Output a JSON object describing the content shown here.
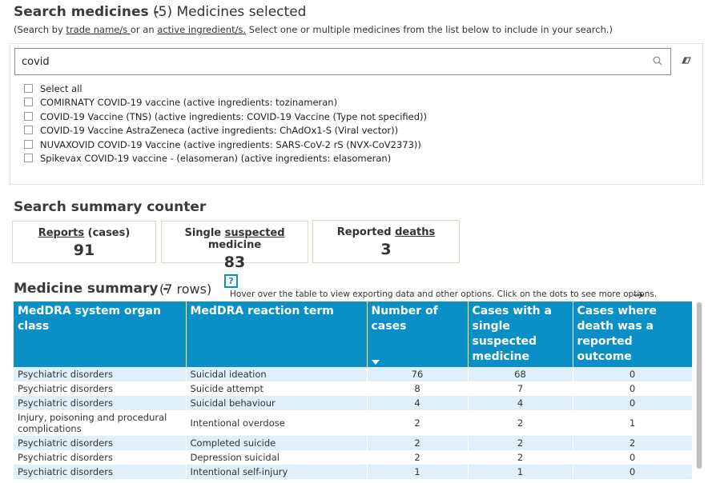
{
  "search": {
    "title": "Search medicines -",
    "selected_count": "(5) Medicines selected",
    "hint_prefix": "(Search by ",
    "hint_link1": "trade name/s ",
    "hint_mid": "or an ",
    "hint_link2": "active ingredient/s.",
    "hint_suffix": " Select one or multiple medicines from the list below to include in your search.)",
    "query": "covid",
    "options": [
      "Select all",
      "COMIRNATY COVID-19 vaccine (active ingredients: tozinameran)",
      "COVID-19 Vaccine (TNS) (active ingredients: COVID-19 Vaccine (Type not specified))",
      "COVID-19 Vaccine AstraZeneca (active ingredients: ChAdOx1-S (Viral vector))",
      "NUVAXOVID COVID-19 Vaccine (active ingredients: SARS-CoV-2 rS (NVX-CoV2373))",
      "Spikevax COVID-19 vaccine - (elasomeran) (active ingredients: elasomeran)"
    ]
  },
  "summary": {
    "title": "Search summary counter",
    "cards": [
      {
        "pre": "",
        "link": "Reports",
        "post": " (cases)",
        "value": "91"
      },
      {
        "pre": "Single ",
        "link": "suspected",
        "post": " medicine",
        "value": "83"
      },
      {
        "pre": "Reported ",
        "link": "deaths",
        "post": "",
        "value": "3"
      }
    ]
  },
  "medicine": {
    "title": "Medicine summary -",
    "rows_label": "(7 rows)",
    "help_label": "?",
    "hover_hint": "Hover over the table to view exporting data and other options. Click on the dots to see more options.",
    "columns": [
      "MedDRA system organ class",
      "MedDRA reaction term",
      "Number of cases",
      "Cases with a single suspected medicine",
      "Cases where death was a reported outcome"
    ],
    "rows": [
      [
        "Psychiatric disorders",
        "Suicidal ideation",
        "76",
        "68",
        "0"
      ],
      [
        "Psychiatric disorders",
        "Suicide attempt",
        "8",
        "7",
        "0"
      ],
      [
        "Psychiatric disorders",
        "Suicidal behaviour",
        "4",
        "4",
        "0"
      ],
      [
        "Injury, poisoning and procedural complications",
        "Intentional overdose",
        "2",
        "2",
        "1"
      ],
      [
        "Psychiatric disorders",
        "Completed suicide",
        "2",
        "2",
        "2"
      ],
      [
        "Psychiatric disorders",
        "Depression suicidal",
        "2",
        "2",
        "0"
      ],
      [
        "Psychiatric disorders",
        "Intentional self-injury",
        "1",
        "1",
        "0"
      ]
    ]
  },
  "icons": {
    "search": "search-icon",
    "clear": "eraser-icon",
    "help": "help-icon",
    "arrow": "arrow-right-icon",
    "sort": "sort-desc-icon"
  },
  "colors": {
    "header_bg": "#0a8fc7",
    "alt_row": "#dff0fb",
    "card_border": "#cfe0c3"
  }
}
